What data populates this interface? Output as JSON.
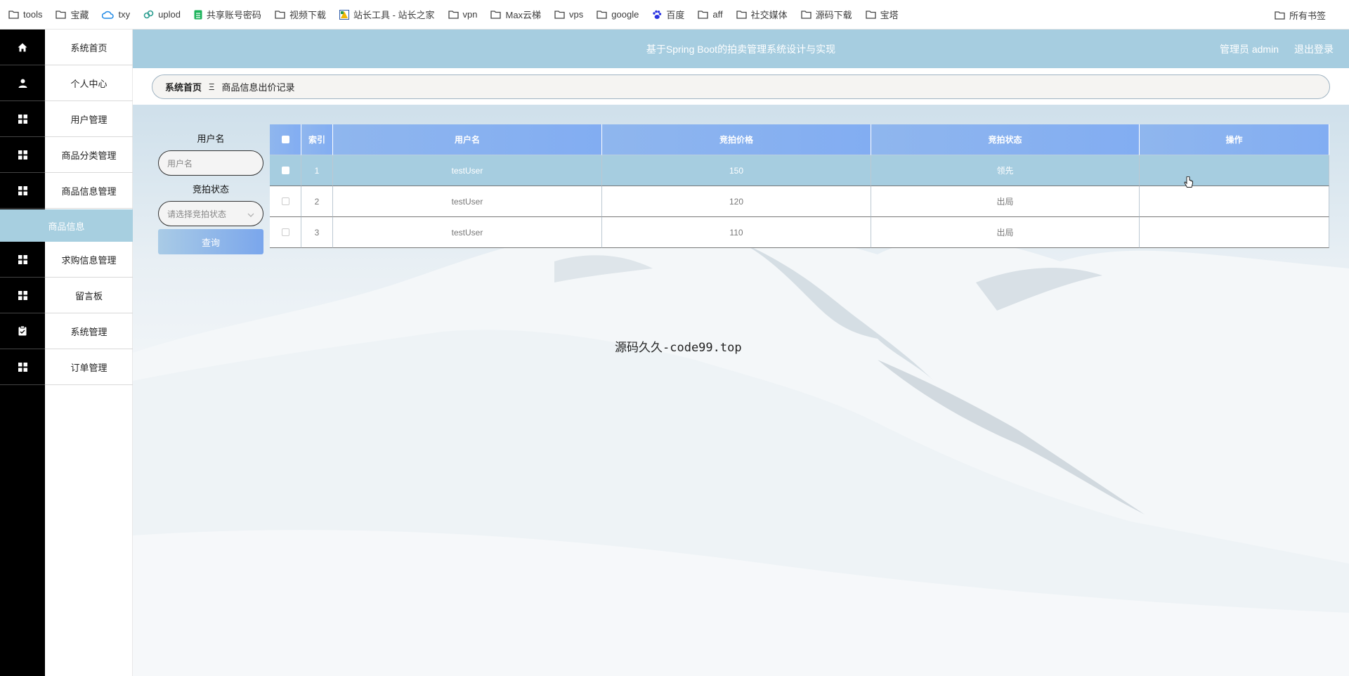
{
  "bookmarks": {
    "items": [
      {
        "label": "tools",
        "icon": "folder-icon"
      },
      {
        "label": "宝藏",
        "icon": "folder-icon"
      },
      {
        "label": "txy",
        "icon": "cloud-icon"
      },
      {
        "label": "uplod",
        "icon": "cloud-link-icon"
      },
      {
        "label": "共享账号密码",
        "icon": "sheet-icon"
      },
      {
        "label": "视频下载",
        "icon": "folder-icon"
      },
      {
        "label": "站长工具 - 站长之家",
        "icon": "site-icon"
      },
      {
        "label": "vpn",
        "icon": "folder-icon"
      },
      {
        "label": "Max云梯",
        "icon": "folder-icon"
      },
      {
        "label": "vps",
        "icon": "folder-icon"
      },
      {
        "label": "google",
        "icon": "folder-icon"
      },
      {
        "label": "百度",
        "icon": "baidu-paw-icon"
      },
      {
        "label": "aff",
        "icon": "folder-icon"
      },
      {
        "label": "社交媒体",
        "icon": "folder-icon"
      },
      {
        "label": "源码下载",
        "icon": "folder-icon"
      },
      {
        "label": "宝塔",
        "icon": "folder-icon"
      }
    ],
    "all_bookmarks": "所有书签"
  },
  "sidebar": {
    "items": [
      {
        "label": "系统首页",
        "icon": "home-icon"
      },
      {
        "label": "个人中心",
        "icon": "user-icon"
      },
      {
        "label": "用户管理",
        "icon": "grid-icon"
      },
      {
        "label": "商品分类管理",
        "icon": "grid-icon"
      },
      {
        "label": "商品信息管理",
        "icon": "grid-icon"
      },
      {
        "label": "求购信息管理",
        "icon": "grid-icon"
      },
      {
        "label": "留言板",
        "icon": "grid-icon"
      },
      {
        "label": "系统管理",
        "icon": "clipboard-icon"
      },
      {
        "label": "订单管理",
        "icon": "grid-icon"
      }
    ],
    "active_sub": "商品信息"
  },
  "header": {
    "title": "基于Spring Boot的拍卖管理系统设计与实现",
    "user": "管理员 admin",
    "logout": "退出登录"
  },
  "breadcrumb": {
    "home": "系统首页",
    "separator": "Ξ",
    "current": "商品信息出价记录"
  },
  "search": {
    "username_label": "用户名",
    "username_placeholder": "用户名",
    "status_label": "竞拍状态",
    "status_placeholder": "请选择竞拍状态",
    "query_button": "查询"
  },
  "table": {
    "headers": [
      "索引",
      "用户名",
      "竞拍价格",
      "竞拍状态",
      "操作"
    ],
    "rows": [
      {
        "index": "1",
        "username": "testUser",
        "price": "150",
        "status": "领先",
        "action": ""
      },
      {
        "index": "2",
        "username": "testUser",
        "price": "120",
        "status": "出局",
        "action": ""
      },
      {
        "index": "3",
        "username": "testUser",
        "price": "110",
        "status": "出局",
        "action": ""
      }
    ]
  },
  "watermark": "源码久久-code99.top",
  "colors": {
    "accent": "#a6cde0",
    "table_header": "#86b0f0",
    "sidebar_dark": "#000000"
  }
}
